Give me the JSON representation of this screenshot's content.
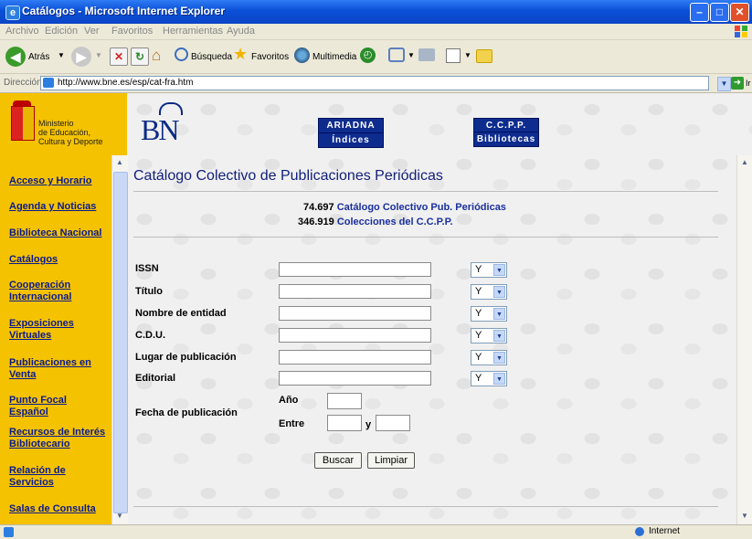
{
  "window": {
    "title": "Catálogos - Microsoft Internet Explorer"
  },
  "menu": [
    "Archivo",
    "Edición",
    "Ver",
    "Favoritos",
    "Herramientas",
    "Ayuda"
  ],
  "toolbar": {
    "back": "Atrás",
    "search": "Búsqueda",
    "favorites": "Favoritos",
    "multimedia": "Multimedia"
  },
  "address": {
    "label": "Dirección",
    "url": "http://www.bne.es/esp/cat-fra.htm",
    "go": "Ir"
  },
  "header": {
    "ministry": [
      "Ministerio",
      "de Educación,",
      "Cultura y Deporte"
    ],
    "bn_logo": "BN",
    "buttons": {
      "ariadna": "ARIADNA",
      "indices": "Índices",
      "ccpp": "C.C.P.P.",
      "bibliotecas": "Bibliotecas"
    }
  },
  "sidebar": {
    "links": [
      "Acceso y Horario",
      "Agenda y Noticias",
      "Biblioteca Nacional",
      "Catálogos",
      "Cooperación Internacional",
      "Exposiciones Virtuales",
      "Publicaciones en Venta",
      "Punto Focal Español",
      "Recursos de Interés Bibliotecario",
      "Relación de Servicios",
      "Salas de Consulta"
    ]
  },
  "main": {
    "title": "Catálogo Colectivo de Publicaciones Periódicas",
    "stats": [
      {
        "number": "74.697",
        "label": "Catálogo Colectivo Pub. Periódicas"
      },
      {
        "number": "346.919",
        "label": "Colecciones del C.C.P.P."
      }
    ],
    "fields": [
      {
        "label": "ISSN",
        "value": "",
        "operator": "Y"
      },
      {
        "label": "Título",
        "value": "",
        "operator": "Y"
      },
      {
        "label": "Nombre de entidad",
        "value": "",
        "operator": "Y"
      },
      {
        "label": "C.D.U.",
        "value": "",
        "operator": "Y"
      },
      {
        "label": "Lugar de publicación",
        "value": "",
        "operator": "Y"
      },
      {
        "label": "Editorial",
        "value": "",
        "operator": "Y"
      }
    ],
    "date": {
      "label": "Fecha de publicación",
      "year_label": "Año",
      "between_label": "Entre",
      "and_label": "y"
    },
    "buttons": {
      "search": "Buscar",
      "clear": "Limpiar"
    }
  },
  "status": {
    "zone": "Internet"
  },
  "colors": {
    "titlebar": "#0a4fd8",
    "sidebar": "#f5c200",
    "link": "#0a1a8f",
    "header_button": "#0e2c8e"
  }
}
